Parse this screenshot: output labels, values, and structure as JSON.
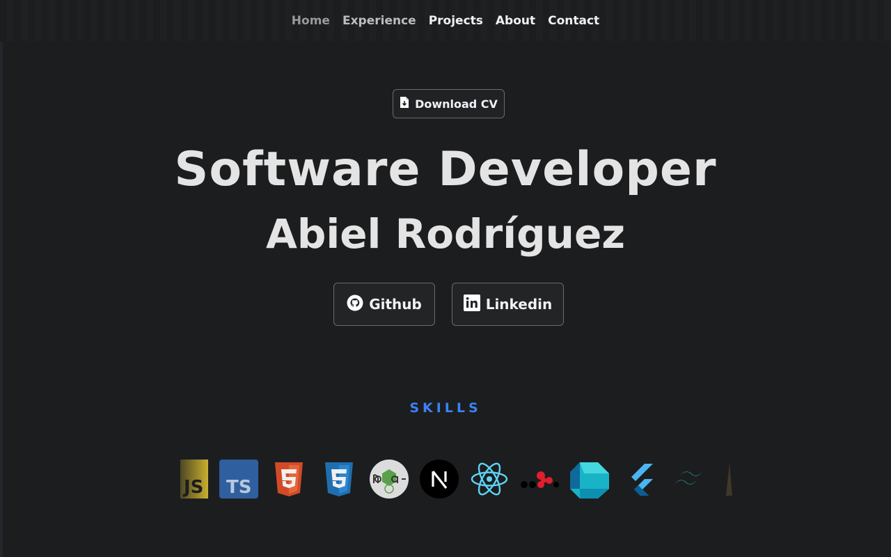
{
  "nav": {
    "items": [
      "Home",
      "Experience",
      "Projects",
      "About",
      "Contact"
    ]
  },
  "cv": {
    "label": "Download CV"
  },
  "hero": {
    "title": "Software Developer",
    "name": "Abiel Rodríguez"
  },
  "social": {
    "github": "Github",
    "linkedin": "Linkedin"
  },
  "skills": {
    "title": "SKILLS",
    "icons": [
      "javascript-icon",
      "typescript-icon",
      "html5-icon",
      "css3-icon",
      "nodejs-icon",
      "nextjs-icon",
      "react-icon",
      "dots-icon",
      "dart-icon",
      "flutter-icon",
      "tailwind-icon",
      "edge-icon"
    ],
    "labels": {
      "js": "JS",
      "ts": "TS"
    }
  },
  "colors": {
    "accent": "#3b82f6",
    "background": "#1c1d1f"
  }
}
